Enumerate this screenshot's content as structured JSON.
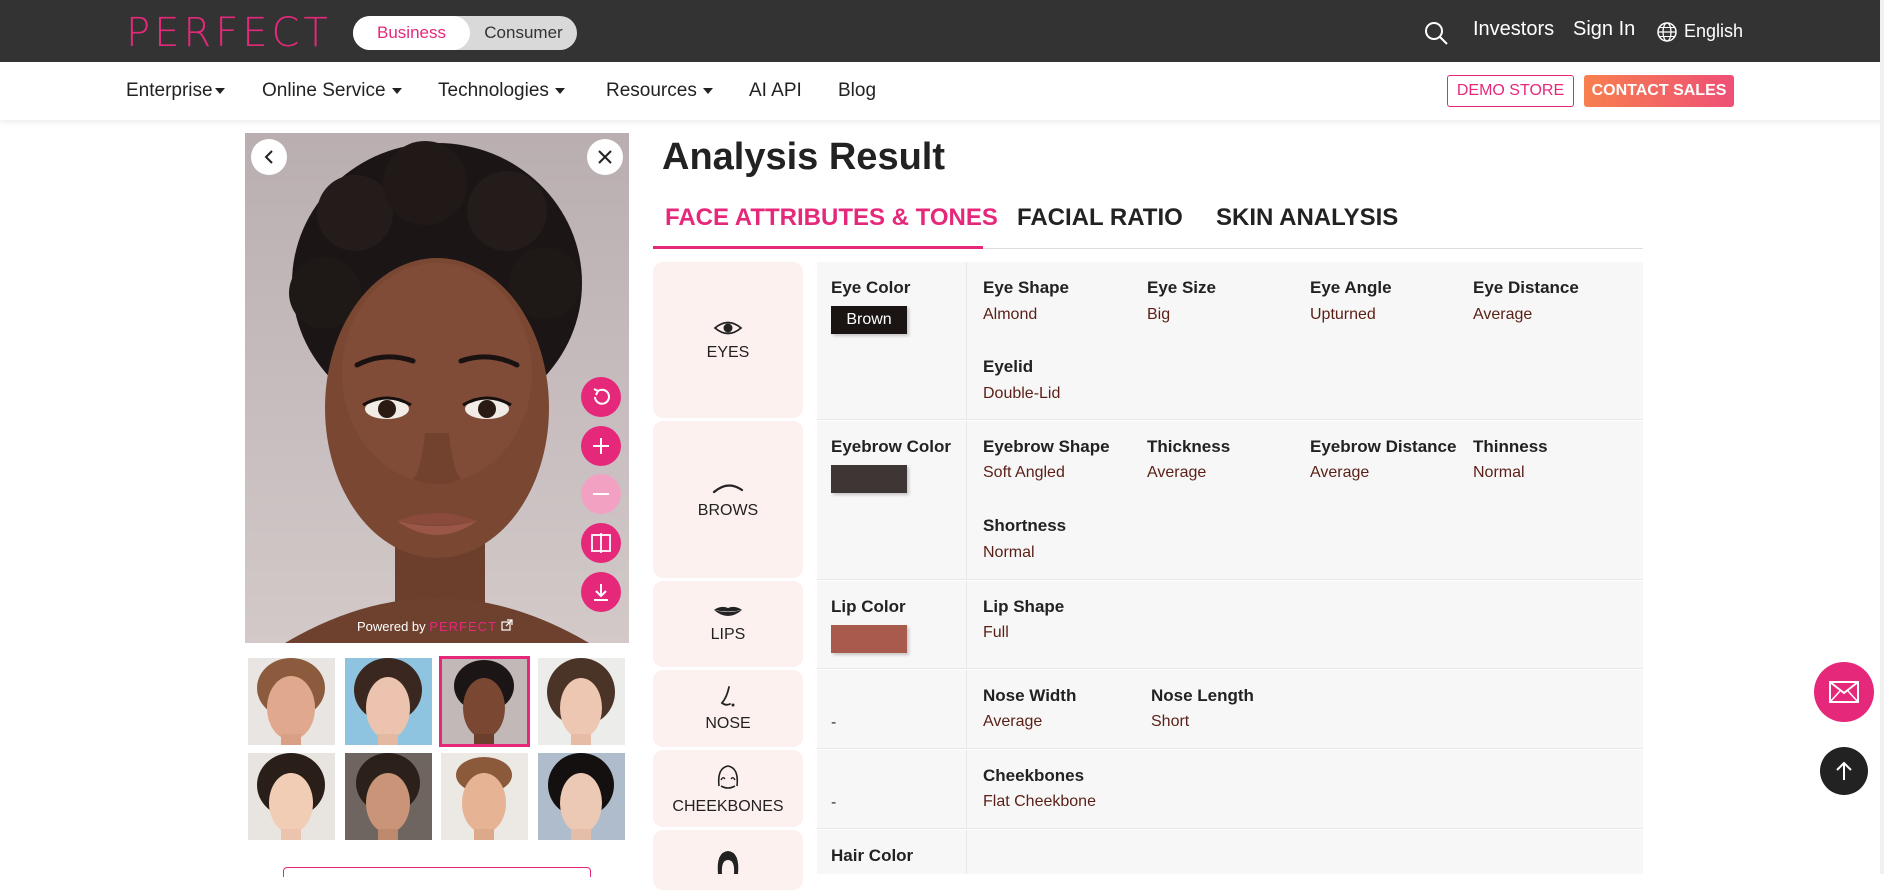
{
  "brand": {
    "logo": "PERFECT",
    "accent": "#e6287b"
  },
  "header": {
    "segment": {
      "business": "Business",
      "consumer": "Consumer"
    },
    "investors": "Investors",
    "sign_in": "Sign In",
    "language": "English"
  },
  "nav": {
    "items": [
      "Enterprise",
      "Online Service",
      "Technologies",
      "Resources",
      "AI API",
      "Blog"
    ],
    "demo_store": "DEMO STORE",
    "contact_sales": "CONTACT SALES"
  },
  "photo": {
    "powered_by": "Powered by",
    "powered_brand": "PERFECT"
  },
  "main": {
    "title": "Analysis Result",
    "tabs": [
      "FACE ATTRIBUTES & TONES",
      "FACIAL RATIO",
      "SKIN ANALYSIS"
    ]
  },
  "rows": {
    "eyes": {
      "category": "EYES",
      "color_label": "Eye Color",
      "color_value": "Brown",
      "color_hex": "#1a1413",
      "attrs": [
        {
          "label": "Eye Shape",
          "value": "Almond"
        },
        {
          "label": "Eye Size",
          "value": "Big"
        },
        {
          "label": "Eye Angle",
          "value": "Upturned"
        },
        {
          "label": "Eye Distance",
          "value": "Average"
        },
        {
          "label": "Eyelid",
          "value": "Double-Lid"
        }
      ]
    },
    "brows": {
      "category": "BROWS",
      "color_label": "Eyebrow Color",
      "color_hex": "#3e3634",
      "attrs": [
        {
          "label": "Eyebrow Shape",
          "value": "Soft Angled"
        },
        {
          "label": "Thickness",
          "value": "Average"
        },
        {
          "label": "Eyebrow Distance",
          "value": "Average"
        },
        {
          "label": "Thinness",
          "value": "Normal"
        },
        {
          "label": "Shortness",
          "value": "Normal"
        }
      ]
    },
    "lips": {
      "category": "LIPS",
      "color_label": "Lip Color",
      "color_hex": "#a85a4c",
      "attrs": [
        {
          "label": "Lip Shape",
          "value": "Full"
        }
      ]
    },
    "nose": {
      "category": "NOSE",
      "color_value": "-",
      "attrs": [
        {
          "label": "Nose Width",
          "value": "Average"
        },
        {
          "label": "Nose Length",
          "value": "Short"
        }
      ]
    },
    "cheekbones": {
      "category": "CHEEKBONES",
      "color_value": "-",
      "attrs": [
        {
          "label": "Cheekbones",
          "value": "Flat Cheekbone"
        }
      ]
    },
    "hair": {
      "color_label": "Hair Color"
    }
  }
}
